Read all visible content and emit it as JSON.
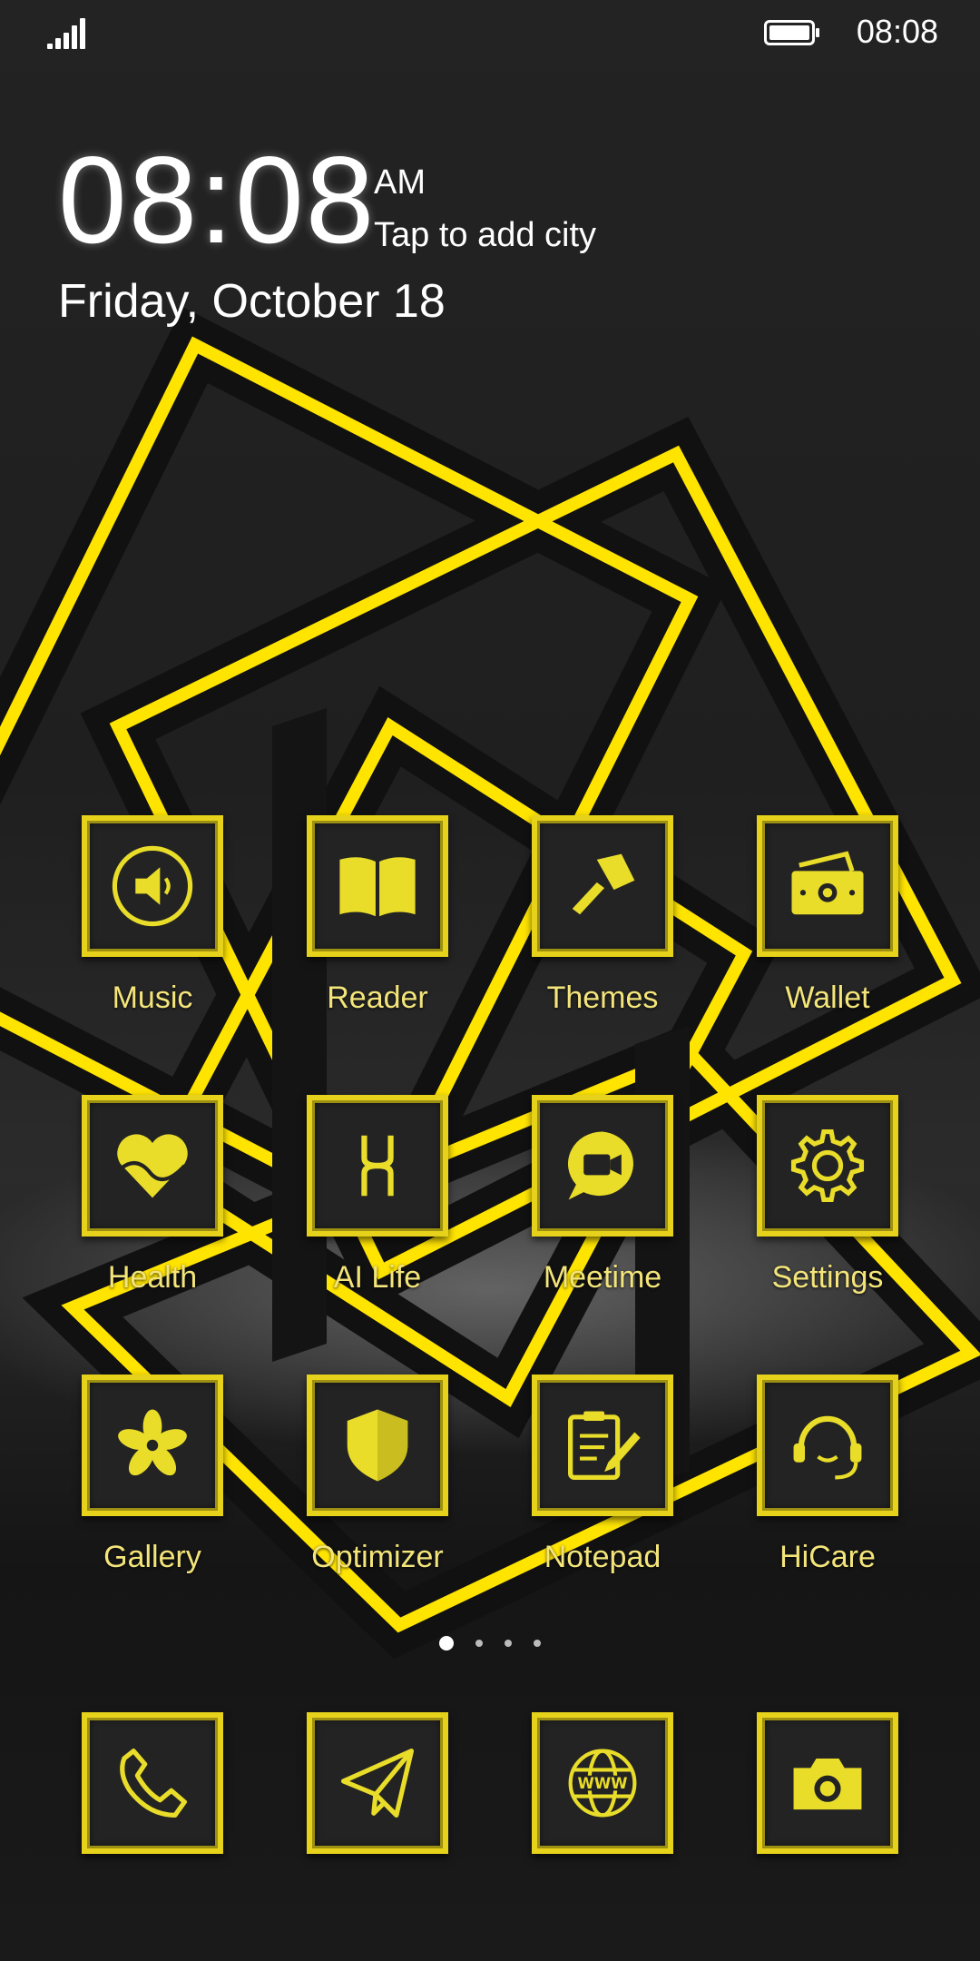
{
  "status_bar": {
    "time": "08:08",
    "battery_level": 1.0
  },
  "clock_widget": {
    "time": "08:08",
    "ampm": "AM",
    "city_prompt": "Tap to add city",
    "date": "Friday, October 18"
  },
  "apps": [
    {
      "label": "Music",
      "icon": "speaker-icon"
    },
    {
      "label": "Reader",
      "icon": "book-icon"
    },
    {
      "label": "Themes",
      "icon": "paintbrush-icon"
    },
    {
      "label": "Wallet",
      "icon": "wallet-icon"
    },
    {
      "label": "Health",
      "icon": "heart-icon"
    },
    {
      "label": "AI Life",
      "icon": "ai-life-icon"
    },
    {
      "label": "Meetime",
      "icon": "video-chat-icon"
    },
    {
      "label": "Settings",
      "icon": "gear-icon"
    },
    {
      "label": "Gallery",
      "icon": "flower-icon"
    },
    {
      "label": "Optimizer",
      "icon": "shield-icon"
    },
    {
      "label": "Notepad",
      "icon": "notepad-icon"
    },
    {
      "label": "HiCare",
      "icon": "headset-icon"
    }
  ],
  "page_indicator": {
    "pages": 4,
    "current": 1
  },
  "dock": [
    {
      "icon": "phone-icon"
    },
    {
      "icon": "paper-plane-icon"
    },
    {
      "icon": "www-globe-icon",
      "text": "WWW"
    },
    {
      "icon": "camera-icon"
    }
  ],
  "colors": {
    "accent": "#e6d21a",
    "label": "#f3e57a",
    "tile_bg": "#232323"
  }
}
